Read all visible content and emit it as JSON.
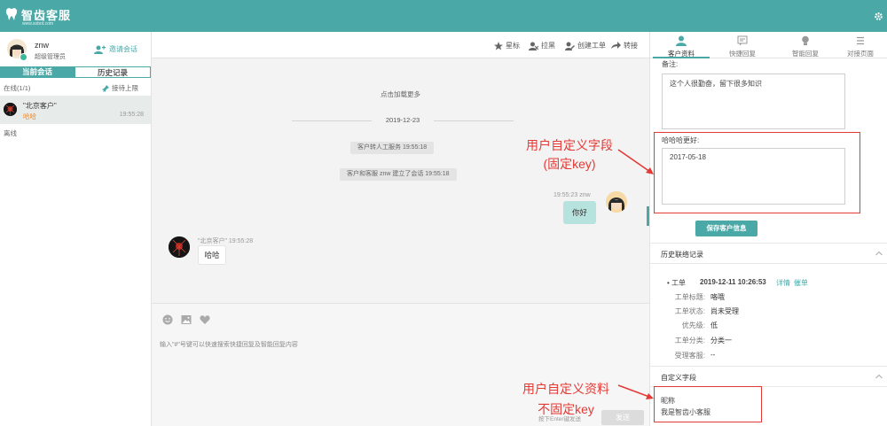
{
  "brand": {
    "name": "智齿客服",
    "sub": "www.sobot.com"
  },
  "agent": {
    "name": "znw",
    "role": "超级管理员",
    "invite_label": "邀请会话"
  },
  "left_tabs": [
    "当前会话",
    "历史记录"
  ],
  "online": {
    "label": "在线(1/1)",
    "limit_label": "接待上限"
  },
  "conversation": {
    "name": "\"北京客户\"",
    "last_msg": "哈哈",
    "time": "19:55:28"
  },
  "offline_label": "离线",
  "toolbar": {
    "star": "星标",
    "block": "拉黑",
    "ticket": "创建工单",
    "transfer": "转接"
  },
  "chat": {
    "load_more": "点击加载更多",
    "date": "2019-12-23",
    "system_msgs": [
      "客户转人工服务 19:55:18",
      "客户和客服 znw 建立了会话 19:55:18"
    ],
    "agent_meta": "19:55:23  znw",
    "agent_msg": "你好",
    "customer_meta": "\"北京客户\"  19:55:28",
    "customer_msg": "哈哈"
  },
  "compose": {
    "hint": "输入\"#\"号键可以快速搜索快捷回复及智能回复内容",
    "send_hint": "按下Enter键发送",
    "send_label": "发送"
  },
  "right_tabs": [
    "客户资料",
    "快捷回复",
    "智能回复",
    "对接页面"
  ],
  "profile": {
    "remark_label": "备注:",
    "remark_value": "这个人很勤奋，留下很多知识",
    "custom_label": "哈哈哈更好:",
    "custom_value": "2017-05-18",
    "save_label": "保存客户信息"
  },
  "history": {
    "title": "历史联络记录",
    "type": "工单",
    "datetime": "2019-12-11 10:26:53",
    "detail_link": "详情",
    "urge_link": "催单",
    "rows": [
      {
        "k": "工单标题:",
        "v": "咯哦"
      },
      {
        "k": "工单状态:",
        "v": "尚未受理"
      },
      {
        "k": "优先级:",
        "v": "低"
      },
      {
        "k": "工单分类:",
        "v": "分类一"
      },
      {
        "k": "受理客服:",
        "v": "--"
      }
    ]
  },
  "custom_section": {
    "title": "自定义字段",
    "nick_label": "昵称",
    "nick_value": "我是智齿小客服"
  },
  "annotations": {
    "fixed_title": "用户自定义字段",
    "fixed_sub": "(固定key)",
    "free_title": "用户自定义资料",
    "free_sub": "不固定key"
  },
  "colors": {
    "brand": "#4aa8a7",
    "annotation": "#e53935",
    "accent_orange": "#f0892b"
  },
  "icons": [
    "tooth-logo-icon",
    "gear-icon",
    "add-user-icon",
    "pin-icon",
    "star-icon",
    "block-user-icon",
    "edit-ticket-icon",
    "transfer-icon",
    "emoji-icon",
    "image-icon",
    "heart-icon",
    "person-icon",
    "quick-reply-icon",
    "bulb-icon",
    "list-icon",
    "chevron-up-icon"
  ]
}
